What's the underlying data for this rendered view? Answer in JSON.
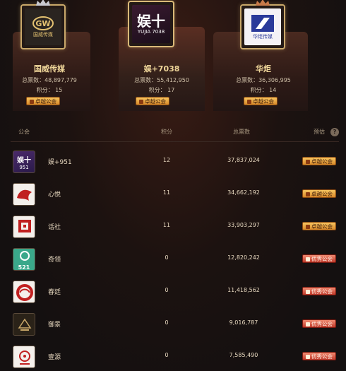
{
  "top3": [
    {
      "rank": "1",
      "name": "娱+7038",
      "votes_label": "总票数：55,412,950",
      "score_label": "积分： 17",
      "badge": "卓越公会",
      "logo_text": "娱十",
      "logo_sub": "YUJIA 7038"
    },
    {
      "rank": "2",
      "name": "国威传媒",
      "votes_label": "总票数：48,897,779",
      "score_label": "积分： 15",
      "badge": "卓越公会",
      "logo_text": "GW",
      "logo_sub": "国威传媒"
    },
    {
      "rank": "3",
      "name": "华炬",
      "votes_label": "总票数：36,306,995",
      "score_label": "积分： 14",
      "badge": "卓越公会",
      "logo_text": "",
      "logo_sub": "华炬传媒"
    }
  ],
  "header": {
    "guild": "公会",
    "score": "积分",
    "votes": "总票数",
    "forecast": "预估",
    "help": "?"
  },
  "rows": [
    {
      "name": "娱+951",
      "score": "12",
      "votes": "37,837,024",
      "badge": "卓越公会",
      "badge_type": "excellent",
      "logo_text": "娱十",
      "logo_sub": "951"
    },
    {
      "name": "心悦",
      "score": "11",
      "votes": "34,662,192",
      "badge": "卓越公会",
      "badge_type": "excellent",
      "logo_text": "",
      "logo_sub": ""
    },
    {
      "name": "话社",
      "score": "11",
      "votes": "33,903,297",
      "badge": "卓越公会",
      "badge_type": "excellent",
      "logo_text": "",
      "logo_sub": ""
    },
    {
      "name": "奇领",
      "score": "0",
      "votes": "12,820,242",
      "badge": "优秀公会",
      "badge_type": "good",
      "logo_text": "",
      "logo_sub": "521"
    },
    {
      "name": "春廷",
      "score": "0",
      "votes": "11,418,562",
      "badge": "优秀公会",
      "badge_type": "good",
      "logo_text": "",
      "logo_sub": ""
    },
    {
      "name": "御景",
      "score": "0",
      "votes": "9,016,787",
      "badge": "优秀公会",
      "badge_type": "good",
      "logo_text": "",
      "logo_sub": ""
    },
    {
      "name": "壹源",
      "score": "0",
      "votes": "7,585,490",
      "badge": "优秀公会",
      "badge_type": "good",
      "logo_text": "",
      "logo_sub": ""
    }
  ],
  "colors": {
    "accent_gold": "#d9b978",
    "badge_excellent": "#e8a040",
    "badge_good": "#d04a36",
    "bg": "#141010"
  }
}
